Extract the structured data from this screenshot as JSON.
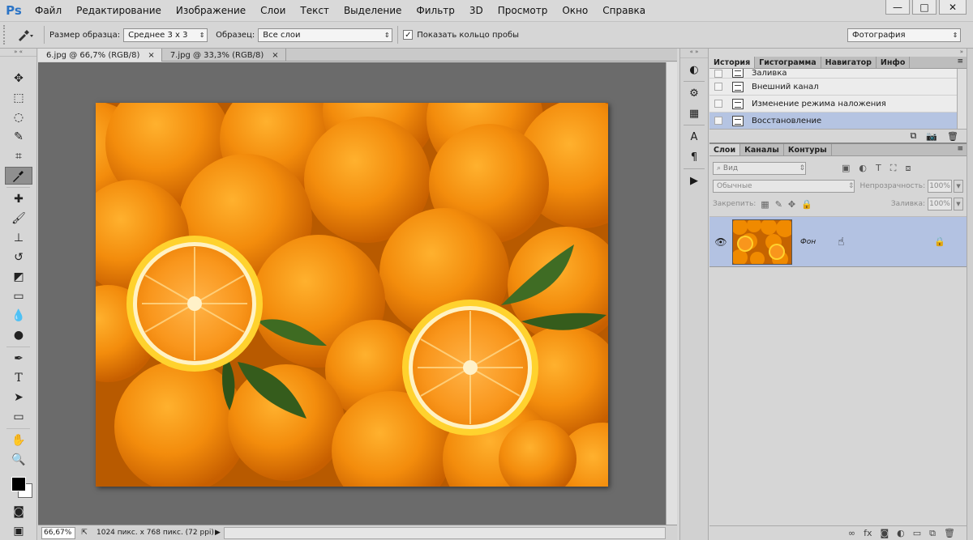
{
  "app": {
    "logo": "Ps"
  },
  "menu": [
    "Файл",
    "Редактирование",
    "Изображение",
    "Слои",
    "Текст",
    "Выделение",
    "Фильтр",
    "3D",
    "Просмотр",
    "Окно",
    "Справка"
  ],
  "window_buttons": {
    "minimize": "—",
    "maximize": "□",
    "close": "✕"
  },
  "options": {
    "sample_size_label": "Размер образца:",
    "sample_size_value": "Среднее 3 х 3",
    "sample_label": "Образец:",
    "sample_value": "Все слои",
    "show_ring_label": "Показать кольцо пробы",
    "show_ring_checked": true,
    "workspace_value": "Фотография"
  },
  "documents": [
    {
      "label": "6.jpg @ 66,7% (RGB/8)",
      "active": true
    },
    {
      "label": "7.jpg @ 33,3% (RGB/8)",
      "active": false
    }
  ],
  "status": {
    "zoom": "66,67%",
    "info": "1024 пикс. x 768 пикс. (72 ppi)"
  },
  "history_panel": {
    "tabs": [
      "История",
      "Гистограмма",
      "Навигатор",
      "Инфо"
    ],
    "items": [
      {
        "label": "Заливка",
        "partial": true
      },
      {
        "label": "Внешний канал"
      },
      {
        "label": "Изменение режима наложения"
      },
      {
        "label": "Восстановление",
        "selected": true
      }
    ]
  },
  "layers_panel": {
    "tabs": [
      "Слои",
      "Каналы",
      "Контуры"
    ],
    "filter_placeholder": "Вид",
    "blend_mode": "Обычные",
    "opacity_label": "Непрозрачность:",
    "opacity_value": "100%",
    "lock_label": "Закрепить:",
    "fill_label": "Заливка:",
    "fill_value": "100%",
    "layers": [
      {
        "name": "Фон",
        "visible": true,
        "locked": true,
        "selected": true
      }
    ]
  },
  "icons": {
    "eyedropper": "eyedropper-icon",
    "eye": "eye-icon",
    "lock": "lock-icon",
    "hand": "hand-cursor-icon"
  },
  "colors": {
    "foreground": "#000000",
    "background": "#ffffff",
    "canvas_bg": "#6b6b6b",
    "selection": "#b3c2e2",
    "orange": "#f08a00"
  }
}
